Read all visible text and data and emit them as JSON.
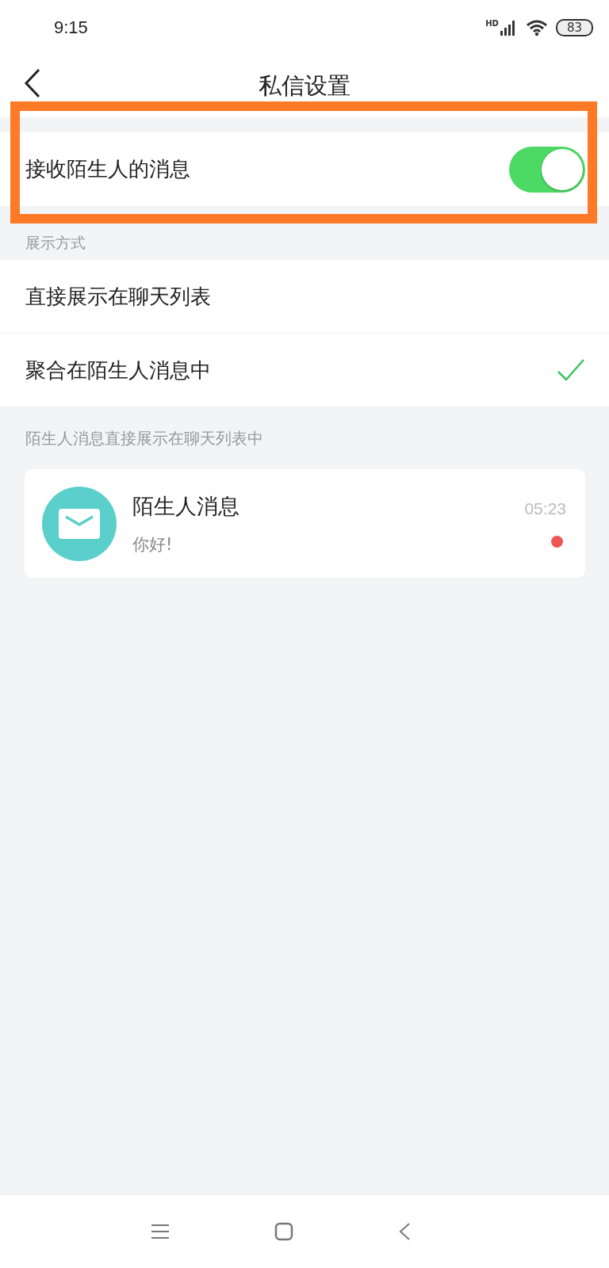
{
  "status_bar": {
    "time": "9:15",
    "network": "HD",
    "battery": "83"
  },
  "nav": {
    "title": "私信设置"
  },
  "toggle": {
    "label": "接收陌生人的消息",
    "on": true,
    "highlighted": true
  },
  "section_header": "展示方式",
  "options": [
    {
      "label": "直接展示在聊天列表",
      "selected": false
    },
    {
      "label": "聚合在陌生人消息中",
      "selected": true
    }
  ],
  "note": "陌生人消息直接展示在聊天列表中",
  "preview": {
    "title": "陌生人消息",
    "message": "你好!",
    "time": "05:23",
    "unread": true
  }
}
